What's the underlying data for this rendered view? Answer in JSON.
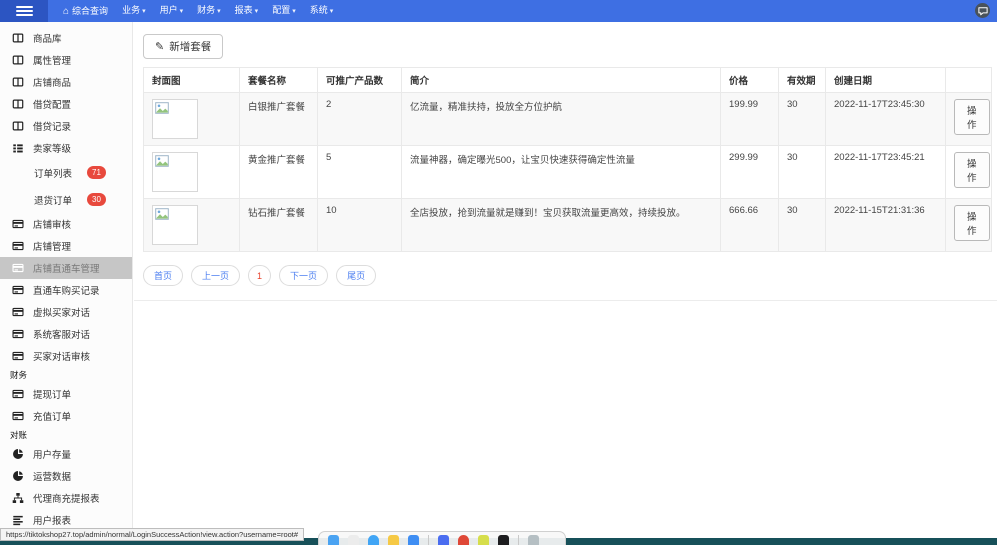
{
  "navbar": {
    "home_label": "综合查询",
    "menus": [
      {
        "label": "业务"
      },
      {
        "label": "用户"
      },
      {
        "label": "财务"
      },
      {
        "label": "报表"
      },
      {
        "label": "配置"
      },
      {
        "label": "系统"
      }
    ]
  },
  "sidebar": {
    "items": [
      {
        "label": "商品库",
        "icon": "table-columns-icon"
      },
      {
        "label": "属性管理",
        "icon": "table-columns-icon"
      },
      {
        "label": "店铺商品",
        "icon": "table-columns-icon"
      },
      {
        "label": "借贷配置",
        "icon": "table-columns-icon"
      },
      {
        "label": "借贷记录",
        "icon": "table-columns-icon"
      },
      {
        "label": "卖家等级",
        "icon": "list-icon"
      },
      {
        "label": "订单列表",
        "badge": "71"
      },
      {
        "label": "退货订单",
        "badge": "30"
      },
      {
        "label": "店铺审核",
        "icon": "card-icon"
      },
      {
        "label": "店铺管理",
        "icon": "card-icon"
      },
      {
        "label": "店铺直通车管理",
        "icon": "card-icon",
        "selected": true
      },
      {
        "label": "直通车购买记录",
        "icon": "card-icon"
      },
      {
        "label": "虚拟买家对话",
        "icon": "card-icon"
      },
      {
        "label": "系统客服对话",
        "icon": "card-icon"
      },
      {
        "label": "买家对话审核",
        "icon": "card-icon"
      },
      {
        "label": "财务",
        "type": "section"
      },
      {
        "label": "提现订单",
        "icon": "card-icon"
      },
      {
        "label": "充值订单",
        "icon": "card-icon"
      },
      {
        "label": "对账",
        "type": "section"
      },
      {
        "label": "用户存量",
        "icon": "pie-icon"
      },
      {
        "label": "运营数据",
        "icon": "pie-icon"
      },
      {
        "label": "代理商充提报表",
        "icon": "sitemap-icon"
      },
      {
        "label": "用户报表",
        "icon": "align-icon"
      }
    ]
  },
  "content": {
    "add_button_label": "新增套餐",
    "table": {
      "headers": [
        "封面图",
        "套餐名称",
        "可推广产品数",
        "简介",
        "价格",
        "有效期",
        "创建日期",
        ""
      ],
      "image_placeholder": "broken-image-icon",
      "rows": [
        {
          "name": "白银推广套餐",
          "count": "2",
          "desc": "亿流量，精准扶持，投放全方位护航",
          "price": "199.99",
          "validity": "30",
          "created": "2022-11-17T23:45:30",
          "action": "操作"
        },
        {
          "name": "黄金推广套餐",
          "count": "5",
          "desc": "流量神器，确定曝光500，让宝贝快速获得确定性流量",
          "price": "299.99",
          "validity": "30",
          "created": "2022-11-17T23:45:21",
          "action": "操作"
        },
        {
          "name": "钻石推广套餐",
          "count": "10",
          "desc": "全店投放，抢到流量就是赚到！宝贝获取流量更高效，持续投放。",
          "price": "666.66",
          "validity": "30",
          "created": "2022-11-15T21:31:36",
          "action": "操作"
        }
      ]
    },
    "pagination": {
      "first": "首页",
      "prev": "上一页",
      "current": "1",
      "next": "下一页",
      "last": "尾页"
    }
  },
  "statusbar": {
    "url": "https://tiktokshop27.top/admin/normal/LoginSuccessAction!view.action?username=root#"
  },
  "dock": {
    "icons": [
      {
        "name": "finder-icon",
        "color": "#4aa3f2"
      },
      {
        "name": "launchpad-icon",
        "color": "#ececec"
      },
      {
        "name": "safari-icon",
        "color": "#41a5f5"
      },
      {
        "name": "notes-icon",
        "color": "#f6c945"
      },
      {
        "name": "appstore-icon",
        "color": "#3f8ef3"
      },
      {
        "name": "app-blue-icon",
        "color": "#4a6df0"
      },
      {
        "name": "app-red-icon",
        "color": "#df4837"
      },
      {
        "name": "app-yellow-icon",
        "color": "#d6de4b"
      },
      {
        "name": "app-black-icon",
        "color": "#1d1d1f"
      },
      {
        "name": "trash-icon",
        "color": "#b5bfc3"
      }
    ]
  },
  "colors": {
    "navbar": "#3e6fe3",
    "navbar_dark_block": "#2c55c2",
    "badge_red": "#e8493d",
    "link_blue": "#4a7df0",
    "current_page_red": "#e8442e",
    "selected_sidebar_bg": "#c6c6c6",
    "desktop_strip": "#175059"
  }
}
